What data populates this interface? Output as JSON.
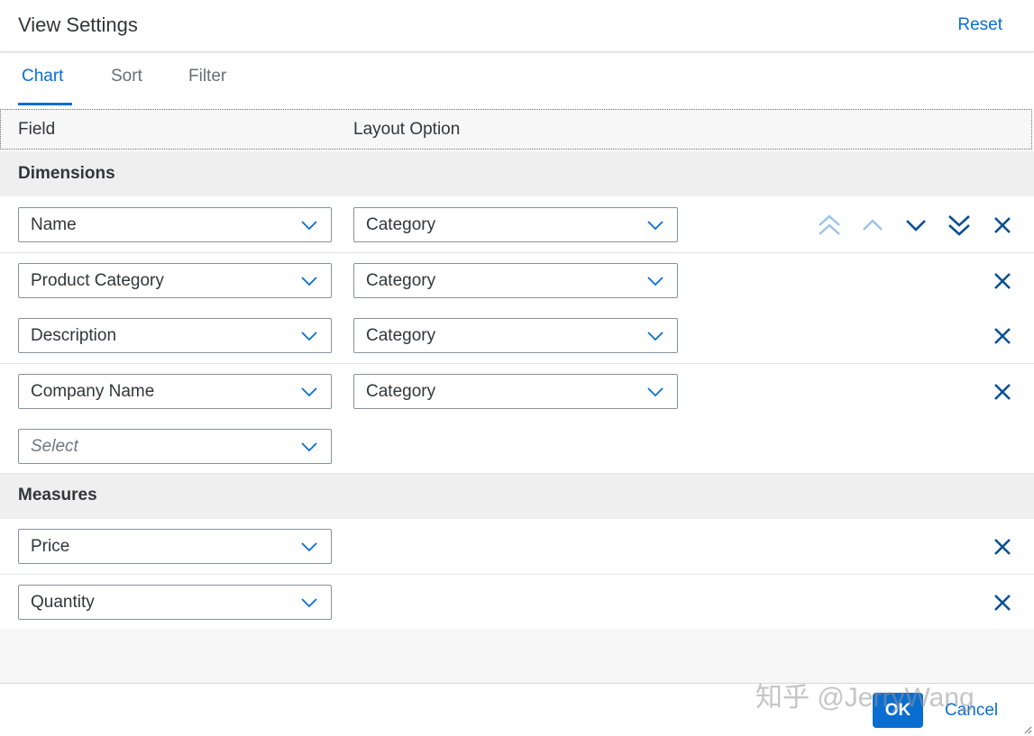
{
  "header": {
    "title": "View Settings",
    "reset_label": "Reset"
  },
  "tabs": [
    {
      "label": "Chart",
      "active": true
    },
    {
      "label": "Sort",
      "active": false
    },
    {
      "label": "Filter",
      "active": false
    }
  ],
  "columns": {
    "field": "Field",
    "layout_option": "Layout Option"
  },
  "dimensions": {
    "label": "Dimensions",
    "items": [
      {
        "field": "Name",
        "layout": "Category"
      },
      {
        "field": "Product Category",
        "layout": "Category"
      },
      {
        "field": "Description",
        "layout": "Category"
      },
      {
        "field": "Company Name",
        "layout": "Category"
      }
    ],
    "select_placeholder": "Select"
  },
  "measures": {
    "label": "Measures",
    "items": [
      {
        "field": "Price"
      },
      {
        "field": "Quantity"
      }
    ]
  },
  "footer": {
    "ok_label": "OK",
    "cancel_label": "Cancel"
  },
  "watermark": "知乎 @JerryWang",
  "colors": {
    "accent": "#0a6ed1",
    "disabled_icon": "#9cc3ea",
    "text": "#32363a"
  }
}
